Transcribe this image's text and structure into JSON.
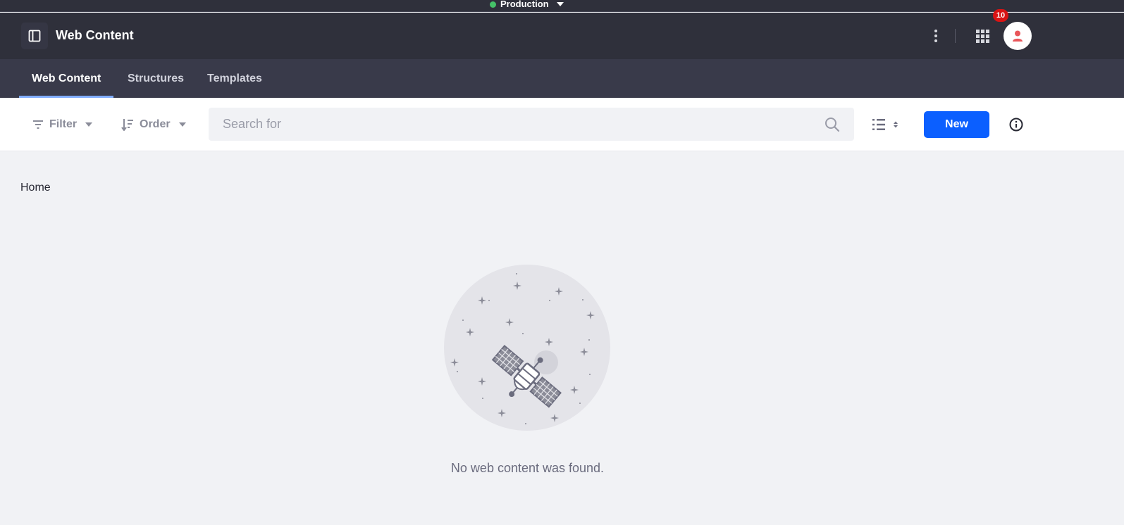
{
  "environment": {
    "label": "Production",
    "status_color": "#45c268"
  },
  "control_bar": {
    "panel_icon": "product-menu-icon",
    "title": "Web Content",
    "notifications_count": "10"
  },
  "nav": {
    "tabs": [
      {
        "label": "Web Content",
        "active": true
      },
      {
        "label": "Structures",
        "active": false
      },
      {
        "label": "Templates",
        "active": false
      }
    ]
  },
  "toolbar": {
    "filter_label": "Filter",
    "order_label": "Order",
    "search_placeholder": "Search for",
    "search_value": "",
    "new_label": "New",
    "accent_color": "#0b5fff"
  },
  "breadcrumb": {
    "current": "Home"
  },
  "empty_state": {
    "illustration": "satellite-icon",
    "message": "No web content was found."
  }
}
